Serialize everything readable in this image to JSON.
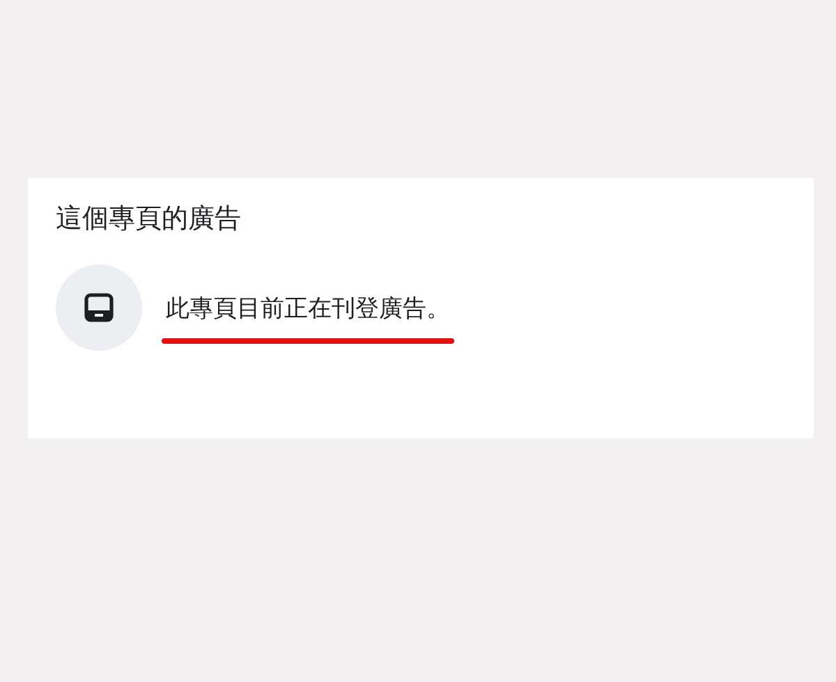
{
  "card": {
    "title": "這個專頁的廣告",
    "status": {
      "text": "此專頁目前正在刊登廣告。",
      "underlined": true
    }
  }
}
